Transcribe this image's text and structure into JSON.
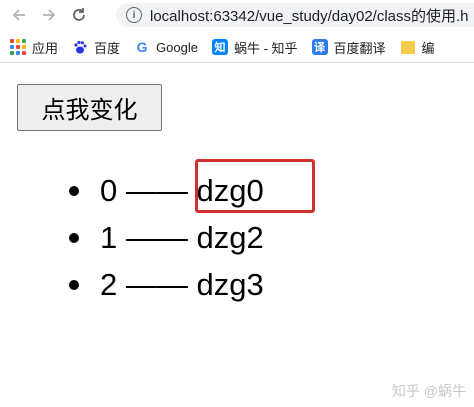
{
  "browser": {
    "url": "localhost:63342/vue_study/day02/class的使用.h"
  },
  "bookmarks": [
    {
      "label": "应用",
      "icon": "apps-grid-icon"
    },
    {
      "label": "百度",
      "icon": "baidu-paw-icon"
    },
    {
      "label": "Google",
      "icon": "google-g-icon"
    },
    {
      "label": "蜗牛 - 知乎",
      "icon": "zhihu-icon",
      "icon_text": "知"
    },
    {
      "label": "百度翻译",
      "icon": "translate-icon",
      "icon_text": "译"
    },
    {
      "label": "编",
      "icon": "folder-icon"
    }
  ],
  "page": {
    "button_label": "点我变化",
    "items": [
      {
        "index": "0",
        "sep": "——",
        "name": "dzg0"
      },
      {
        "index": "1",
        "sep": "——",
        "name": "dzg2"
      },
      {
        "index": "2",
        "sep": "——",
        "name": "dzg3"
      }
    ]
  },
  "watermark": "知乎 @蜗牛",
  "colors": {
    "highlight_border": "#d0312d",
    "button_bg": "#efefef",
    "address_bg": "#f1f3f4"
  }
}
